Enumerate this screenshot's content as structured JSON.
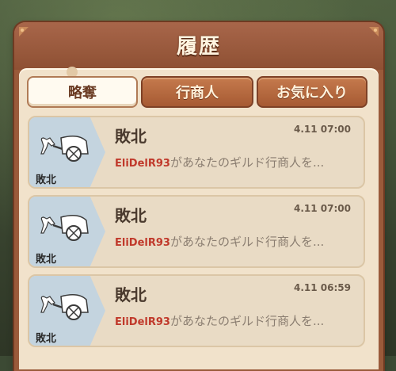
{
  "window": {
    "title": "履歴"
  },
  "tabs": [
    {
      "label": "略奪",
      "active": true
    },
    {
      "label": "行商人",
      "active": false
    },
    {
      "label": "お気に入り",
      "active": false
    }
  ],
  "records": [
    {
      "icon": "caravan-icon",
      "icon_label": "敗北",
      "title": "敗北",
      "time": "4.11 07:00",
      "player": "EliDelR93",
      "message": "があなたのギルド行商人を..."
    },
    {
      "icon": "caravan-icon",
      "icon_label": "敗北",
      "title": "敗北",
      "time": "4.11 07:00",
      "player": "EliDelR93",
      "message": "があなたのギルド行商人を..."
    },
    {
      "icon": "caravan-icon",
      "icon_label": "敗北",
      "title": "敗北",
      "time": "4.11 06:59",
      "player": "EliDelR93",
      "message": "があなたのギルド行商人を..."
    }
  ],
  "colors": {
    "panel": "#9a5a3a",
    "content_bg": "#f1e2cb",
    "card_bg": "#e9dbc5",
    "icon_bg": "#c4d4df",
    "player_name": "#c0392b",
    "tab_active": "#fffaf0",
    "tab_inactive": "#b8683e"
  }
}
